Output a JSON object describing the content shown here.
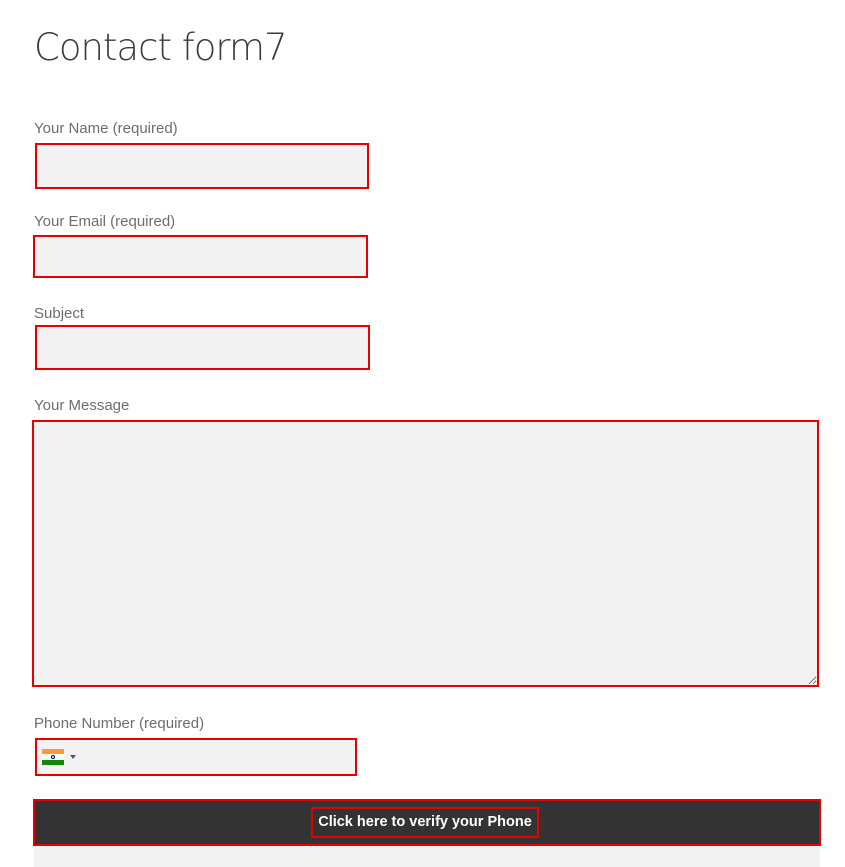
{
  "page": {
    "title": "Contact form7"
  },
  "form": {
    "name": {
      "label": "Your Name (required)",
      "value": "",
      "placeholder": ""
    },
    "email": {
      "label": "Your Email (required)",
      "value": "",
      "placeholder": ""
    },
    "subject": {
      "label": "Subject",
      "value": "",
      "placeholder": ""
    },
    "message": {
      "label": "Your Message",
      "value": "",
      "placeholder": ""
    },
    "phone": {
      "label": "Phone Number (required)",
      "value": "",
      "placeholder": "",
      "country_icon": "india-flag-icon"
    },
    "verify_button_label": "Click here to verify your Phone"
  },
  "colors": {
    "error_border": "#e50000",
    "input_background": "#f2f2f2",
    "button_background": "#333333",
    "button_text": "#ffffff",
    "label_text": "#6d6d6d",
    "title_text": "#3b3b3b"
  }
}
